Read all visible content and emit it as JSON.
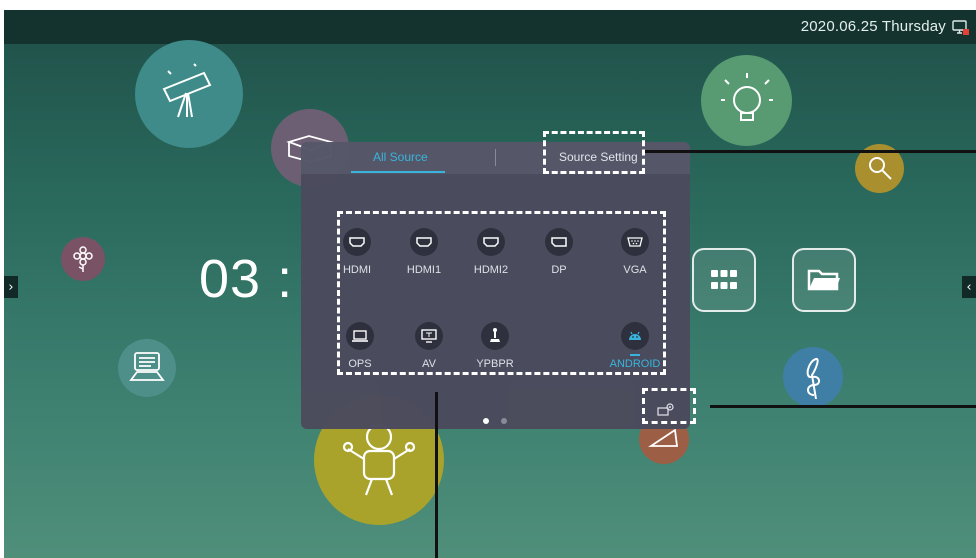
{
  "topbar": {
    "datetime": "2020.06.25 Thursday",
    "screen_icon": "screen-record-icon"
  },
  "home": {
    "clock": "03 :",
    "bubbles": [
      "telescope-icon",
      "book-icon",
      "flower-icon",
      "computer-icon",
      "lightbulb-icon",
      "magnifier-icon",
      "music-note-icon",
      "robot-icon",
      "cheese-icon"
    ],
    "apps": [
      "app-grid-icon",
      "folder-icon"
    ],
    "left_arrow": "›",
    "right_arrow": "‹"
  },
  "panel": {
    "tabs": [
      {
        "label": "All Source",
        "active": true
      },
      {
        "label": "Source Setting",
        "active": false
      }
    ],
    "sources": [
      {
        "label": "HDMI",
        "icon": "hdmi-port-icon"
      },
      {
        "label": "HDMI1",
        "icon": "hdmi-port-icon"
      },
      {
        "label": "HDMI2",
        "icon": "hdmi-port-icon"
      },
      {
        "label": "DP",
        "icon": "displayport-icon"
      },
      {
        "label": "VGA",
        "icon": "vga-port-icon"
      },
      {
        "label": "OPS",
        "icon": "laptop-icon"
      },
      {
        "label": "AV",
        "icon": "tv-icon"
      },
      {
        "label": "YPBPR",
        "icon": "joystick-icon"
      },
      {
        "label": "ANDROID",
        "icon": "android-icon",
        "active": true
      }
    ],
    "pagination": {
      "pages": 2,
      "current": 1
    },
    "settings_icon": "source-settings-icon"
  },
  "colors": {
    "accent": "#3ab6e0",
    "panel": "#4b4b5d",
    "topbar": "#14332f"
  }
}
